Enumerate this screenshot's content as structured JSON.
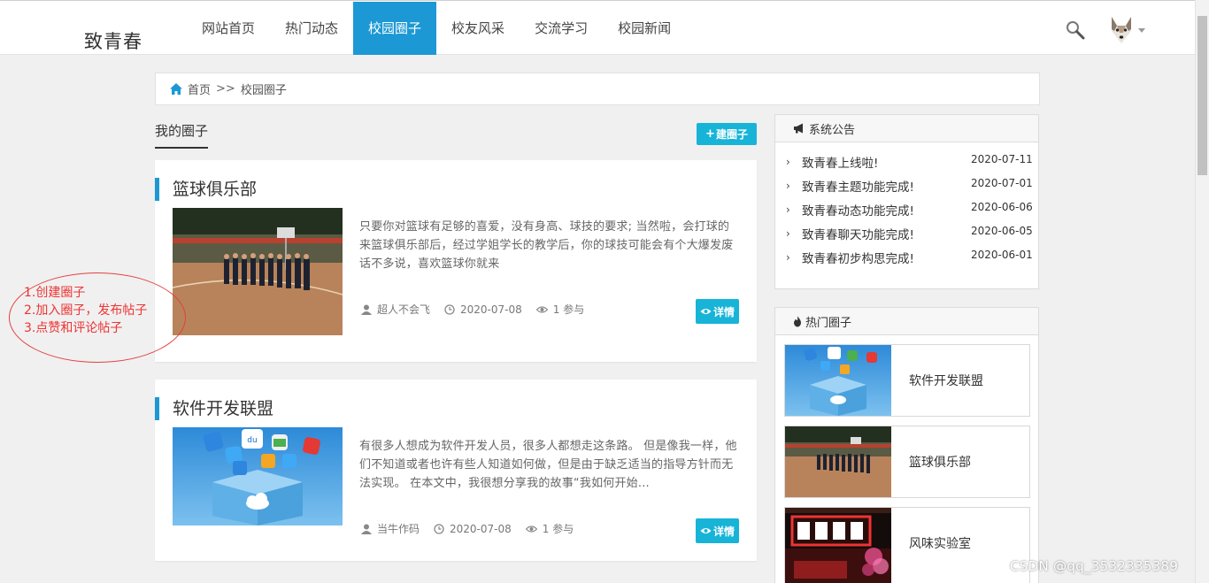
{
  "header": {
    "brand": "致青春",
    "nav": [
      "网站首页",
      "热门动态",
      "校园圈子",
      "校友风采",
      "交流学习",
      "校园新闻"
    ],
    "active_nav": "校园圈子"
  },
  "breadcrumb": {
    "home": "首页",
    "separator": ">>",
    "current": "校园圈子"
  },
  "section": {
    "title": "我的圈子",
    "create_button": "建圈子",
    "create_icon": "+"
  },
  "cards": [
    {
      "title": "篮球俱乐部",
      "description": "只要你对篮球有足够的喜爱，没有身高、球技的要求; 当然啦，会打球的来篮球俱乐部后，经过学姐学长的教学后，你的球技可能会有个大爆发废话不多说，喜欢篮球你就来",
      "author": "超人不会飞",
      "date": "2020-07-08",
      "participants": "1 参与",
      "detail_label": "详情",
      "thumb": "basketball-court"
    },
    {
      "title": "软件开发联盟",
      "description": "有很多人想成为软件开发人员，很多人都想走这条路。 但是像我一样，他们不知道或者也许有些人知道如何做，但是由于缺乏适当的指导方针而无法实现。 在本文中，我很想分享我的故事“我如何开始...",
      "author": "当牛作码",
      "date": "2020-07-08",
      "participants": "1 参与",
      "detail_label": "详情",
      "thumb": "app-box"
    }
  ],
  "annotation": {
    "lines": [
      "1.创建圈子",
      "2.加入圈子，发布帖子",
      "3.点赞和评论帖子"
    ],
    "color": "#e33333"
  },
  "notices": {
    "title": "系统公告",
    "items": [
      {
        "text": "致青春上线啦!",
        "date": "2020-07-11"
      },
      {
        "text": "致青春主题功能完成!",
        "date": "2020-07-01"
      },
      {
        "text": "致青春动态功能完成!",
        "date": "2020-06-06"
      },
      {
        "text": "致青春聊天功能完成!",
        "date": "2020-06-05"
      },
      {
        "text": "致青春初步构思完成!",
        "date": "2020-06-01"
      }
    ]
  },
  "hot": {
    "title": "热门圈子",
    "items": [
      {
        "name": "软件开发联盟",
        "thumb": "app-box"
      },
      {
        "name": "篮球俱乐部",
        "thumb": "basketball-court"
      },
      {
        "name": "风味实验室",
        "thumb": "night-sign"
      }
    ]
  },
  "watermark": "CSDN @qq_3532335389",
  "colors": {
    "accent": "#1c98d5",
    "button": "#17b4d8",
    "background": "#f0f0f0"
  }
}
